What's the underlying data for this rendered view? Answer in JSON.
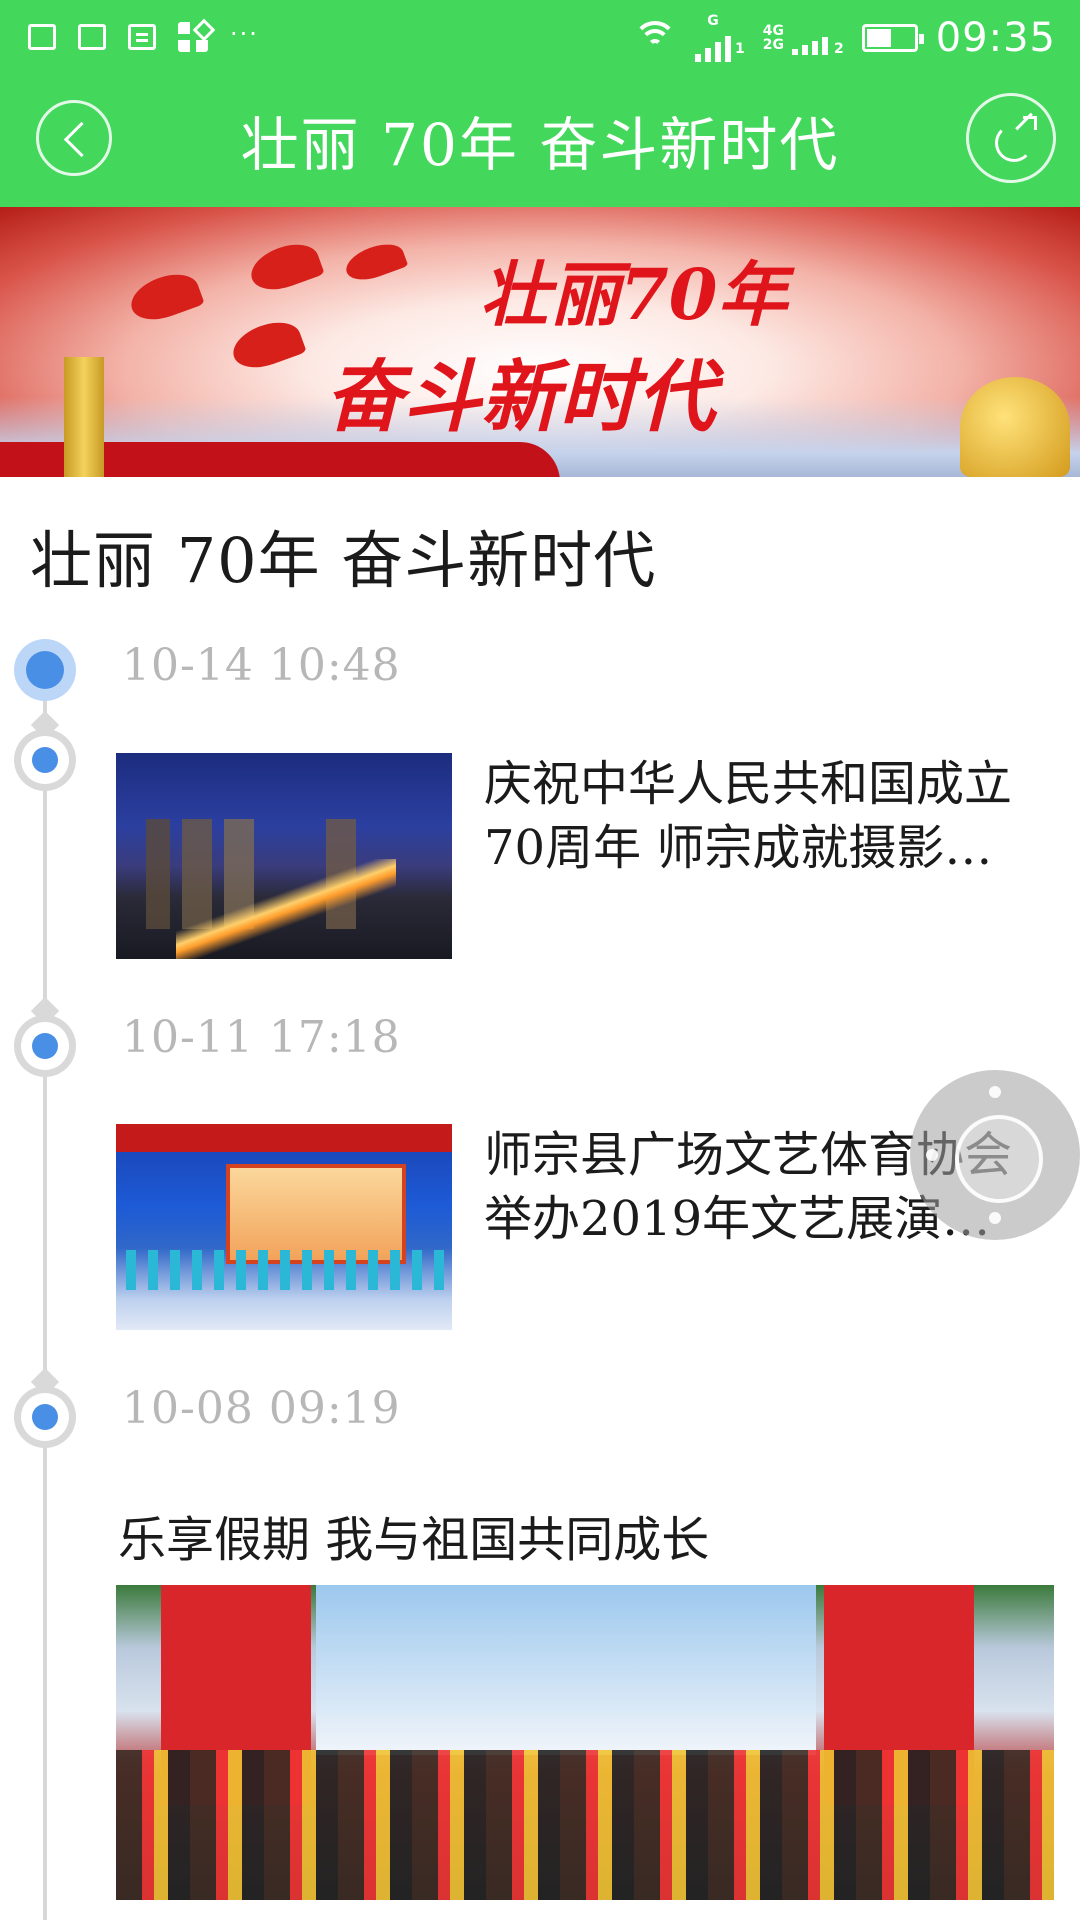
{
  "status_bar": {
    "time": "09:35",
    "dots": "···",
    "net_label_top": "G",
    "net_label_mid": "4G",
    "net_label_bot": "2G",
    "sim1": "1",
    "sim2": "2"
  },
  "header": {
    "title": "壮丽  70年    奋斗新时代",
    "back_icon": "back-icon",
    "share_icon": "share-icon",
    "background_color": "#43d85c"
  },
  "banner": {
    "line1": "壮丽70年",
    "line2": "奋斗新时代"
  },
  "page_title": "壮丽  70年    奋斗新时代",
  "timeline": [
    {
      "timestamp": "10-14  10:48",
      "title": "庆祝中华人民共和国成立70周年  师宗成就摄影…"
    },
    {
      "timestamp": "10-11  17:18",
      "title": "师宗县广场文艺体育协会举办2019年文艺展演…"
    },
    {
      "timestamp": "10-08  09:19",
      "title": "乐享假期  我与祖国共同成长"
    }
  ],
  "colors": {
    "accent_green": "#43d85c",
    "timeline_dot": "#4a8fe6",
    "timestamp_gray": "#b7b7b7"
  }
}
